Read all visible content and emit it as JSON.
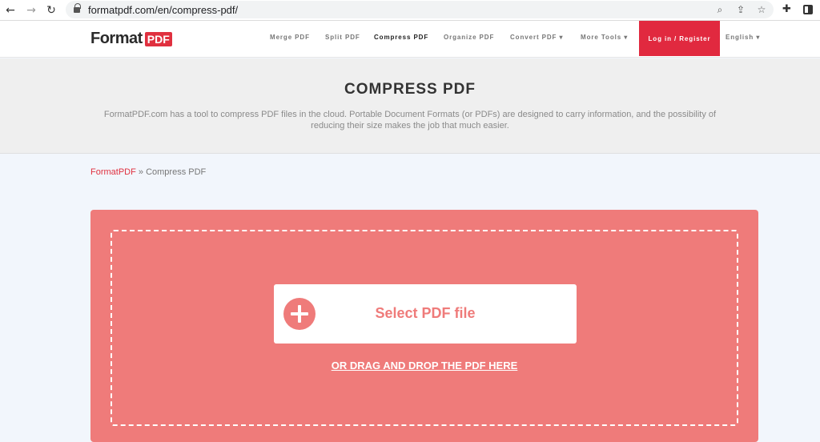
{
  "browser": {
    "url": "formatpdf.com/en/compress-pdf/"
  },
  "header": {
    "logo_text": "Format",
    "logo_badge": "PDF",
    "nav": [
      {
        "label": "Merge PDF"
      },
      {
        "label": "Split PDF"
      },
      {
        "label": "Compress PDF"
      },
      {
        "label": "Organize PDF"
      },
      {
        "label": "Convert PDF ▾"
      },
      {
        "label": "More Tools ▾"
      }
    ],
    "login_label": "Log in / Register",
    "language_label": "English ▾"
  },
  "hero": {
    "title": "COMPRESS PDF",
    "description": "FormatPDF.com has a tool to compress PDF files in the cloud. Portable Document Formats (or PDFs) are designed to carry information, and the possibility of reducing their size makes the job that much easier."
  },
  "breadcrumb": {
    "home": "FormatPDF",
    "separator": " » ",
    "current": "Compress PDF"
  },
  "upload": {
    "select_label": "Select PDF file",
    "drag_label": "OR DRAG AND DROP THE PDF HERE"
  },
  "colors": {
    "brand_red": "#e0303f",
    "panel_salmon": "#ef7b7a"
  }
}
